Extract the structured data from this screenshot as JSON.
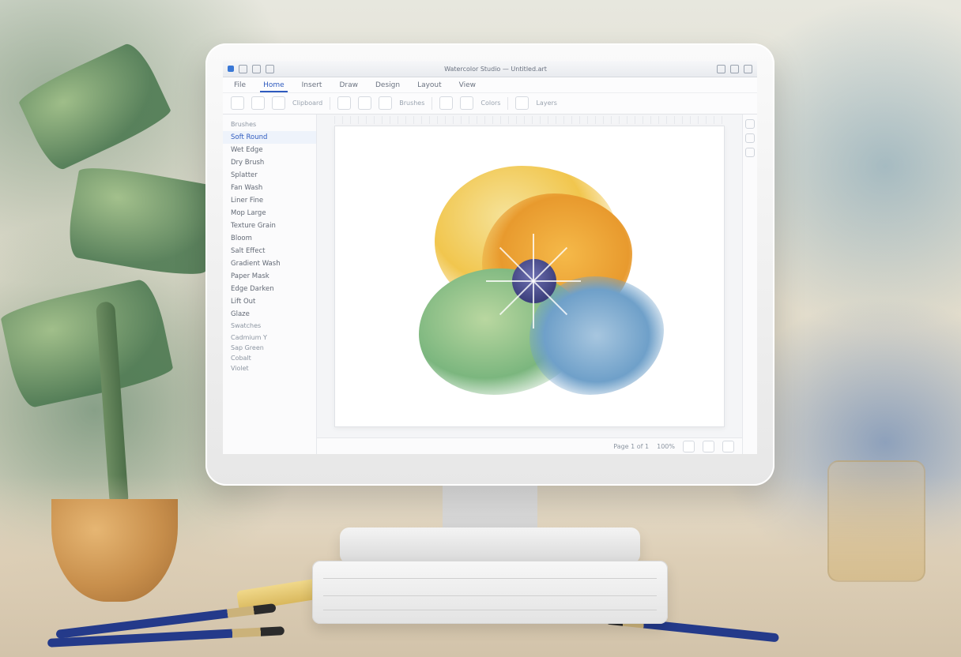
{
  "app": {
    "title": "Watercolor Studio — Untitled.art"
  },
  "ribbon": {
    "tabs": [
      "File",
      "Home",
      "Insert",
      "Draw",
      "Design",
      "Layout",
      "View"
    ],
    "active_tab_index": 1,
    "group_labels": [
      "Clipboard",
      "Brushes",
      "Colors",
      "Layers"
    ]
  },
  "sidebar": {
    "header_a": "Brushes",
    "header_b": "Swatches",
    "items": [
      "Soft Round",
      "Wet Edge",
      "Dry Brush",
      "Splatter",
      "Fan Wash",
      "Liner Fine",
      "Mop Large",
      "Texture Grain",
      "Bloom",
      "Salt Effect",
      "Gradient Wash",
      "Paper Mask",
      "Edge Darken",
      "Lift Out",
      "Glaze"
    ],
    "selected_index": 0,
    "swatches": [
      "Cadmium Y",
      "Sap Green",
      "Cobalt",
      "Violet"
    ]
  },
  "statusbar": {
    "zoom": "100%",
    "page": "Page 1 of 1"
  },
  "colors": {
    "accent": "#2f5bbf",
    "panel": "#fbfbfc",
    "border": "#e6e8ec"
  }
}
